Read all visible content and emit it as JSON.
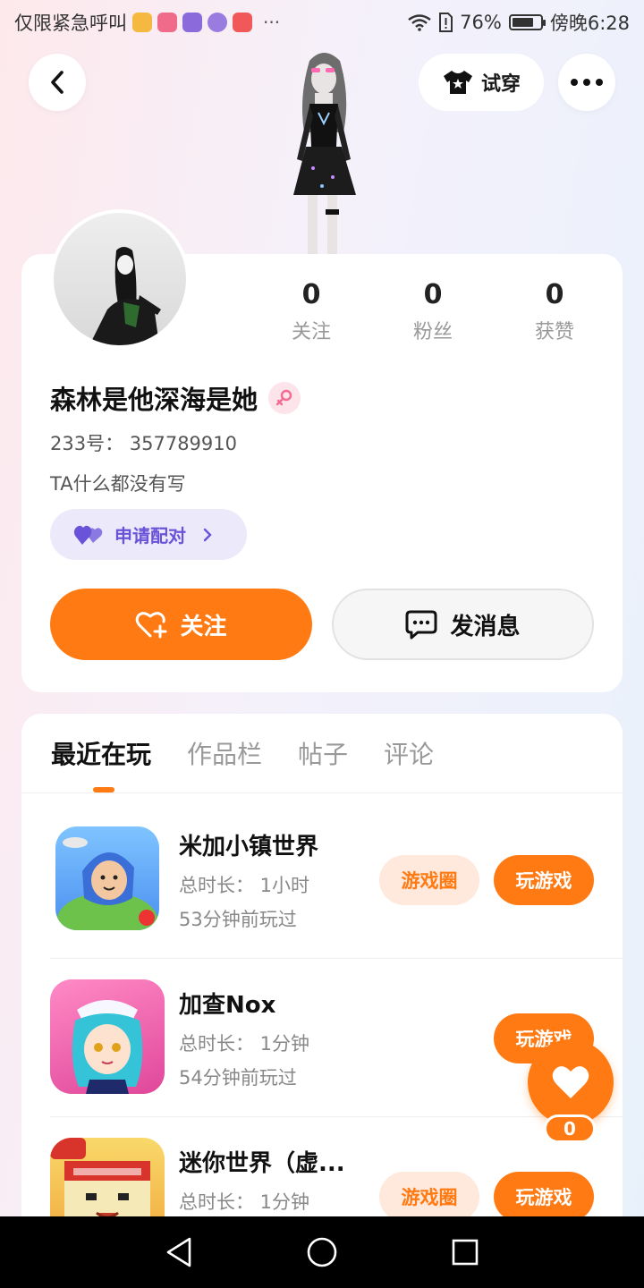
{
  "status_bar": {
    "left_text": "仅限紧急呼叫",
    "overflow": "···",
    "battery": "76%",
    "battery_level": 0.76,
    "time": "傍晚6:28",
    "app_icons": [
      "#f5b942",
      "#f06a8a",
      "#8b6bdc",
      "#9a7ce0",
      "#f0585a"
    ]
  },
  "header": {
    "back_icon": "chevron-left-icon",
    "try_on_label": "试穿",
    "try_on_icon": "tshirt-icon",
    "more_icon": "more-horizontal-icon"
  },
  "profile": {
    "stats": [
      {
        "value": "0",
        "label": "关注"
      },
      {
        "value": "0",
        "label": "粉丝"
      },
      {
        "value": "0",
        "label": "获赞"
      }
    ],
    "username": "森林是他深海是她",
    "gender_icon": "female-icon",
    "user_id": "233号：  357789910",
    "bio": "TA什么都没有写",
    "pair_label": "申请配对",
    "follow_label": "关注",
    "message_label": "发消息"
  },
  "tabs": [
    {
      "label": "最近在玩",
      "active": true
    },
    {
      "label": "作品栏",
      "active": false
    },
    {
      "label": "帖子",
      "active": false
    },
    {
      "label": "评论",
      "active": false
    }
  ],
  "games": [
    {
      "title": "米加小镇世界",
      "duration": "总时长：  1小时",
      "last_played": "53分钟前玩过",
      "circle_label": "游戏圈",
      "play_label": "玩游戏",
      "has_circle": true
    },
    {
      "title": "加查Nox",
      "duration": "总时长：  1分钟",
      "last_played": "54分钟前玩过",
      "play_label": "玩游戏",
      "has_circle": false
    },
    {
      "title": "迷你世界（虚...",
      "duration": "总时长：  1分钟",
      "circle_label": "游戏圈",
      "play_label": "玩游戏",
      "has_circle": true
    }
  ],
  "like_fab": {
    "count": "0",
    "icon": "heart-icon"
  },
  "colors": {
    "accent": "#ff7a12",
    "pair": "#6a53d8"
  }
}
